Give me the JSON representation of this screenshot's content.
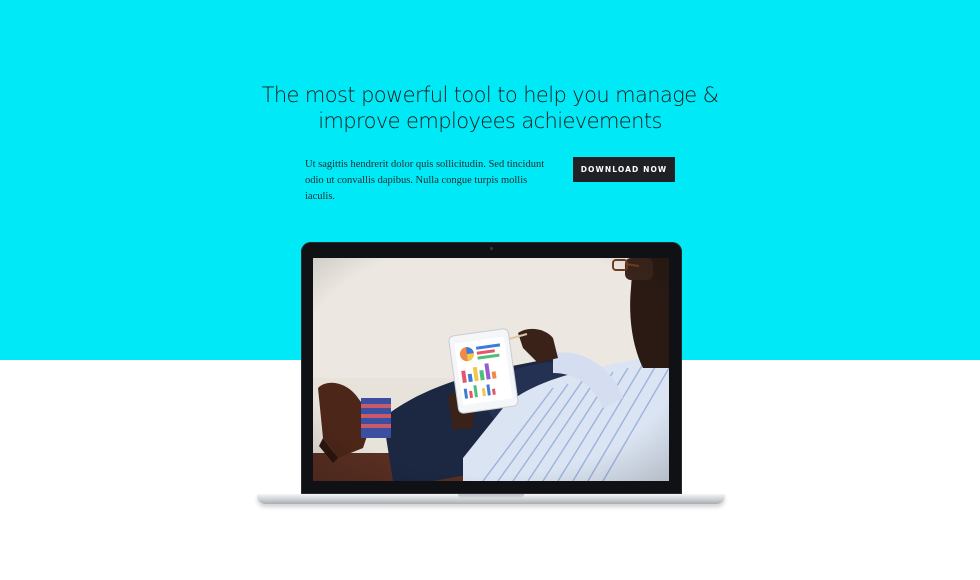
{
  "hero": {
    "background_color": "#00e9f6",
    "headline_line1": "The most powerful tool to help you manage &",
    "headline_line2": "improve employees achievements",
    "intro_text": "Ut sagittis hendrerit dolor quis sollicitudin. Sed tincidunt odio ut convallis dapibus. Nulla congue turpis mollis iaculis.",
    "cta_label": "DOWNLOAD NOW",
    "cta_color": "#1f2124"
  },
  "laptop": {
    "screen_image": "man-using-tablet-with-charts-photo"
  }
}
